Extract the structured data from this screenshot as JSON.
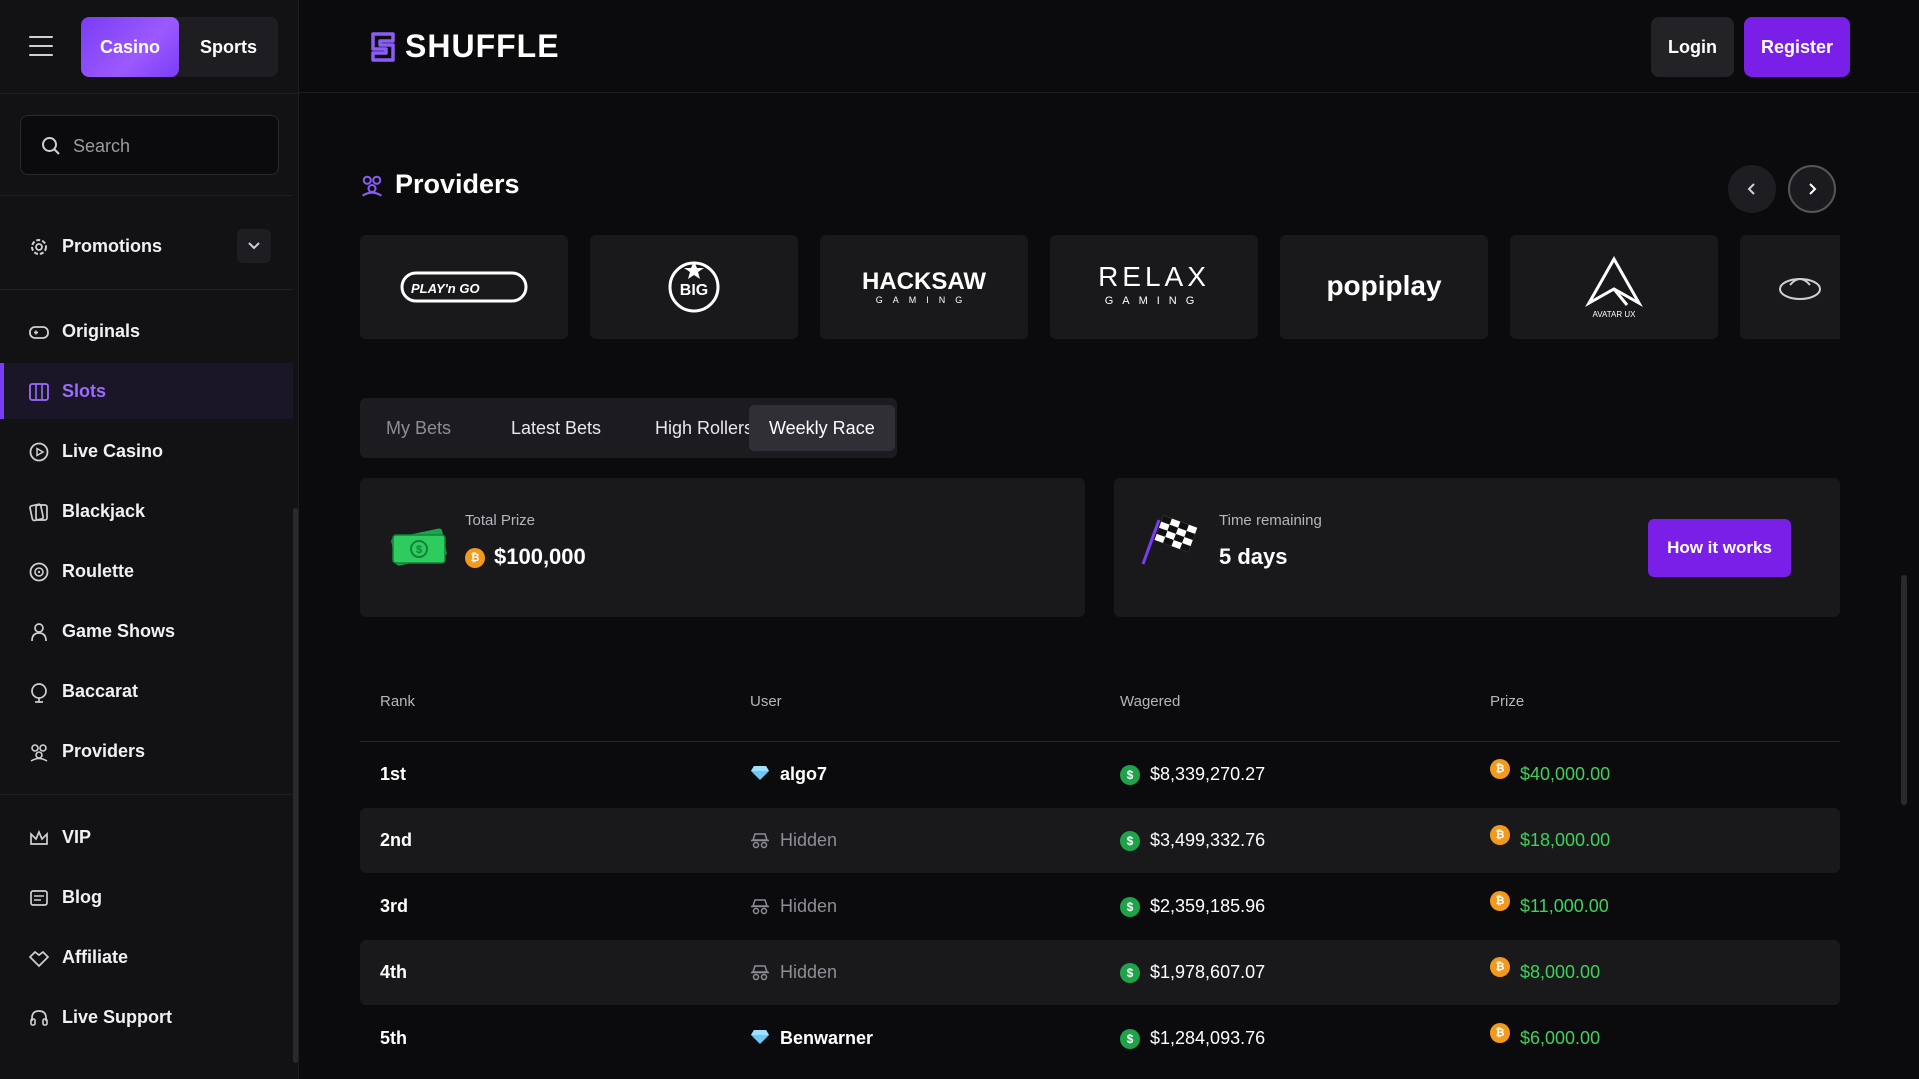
{
  "header": {
    "modes": [
      "Casino",
      "Sports"
    ],
    "brand": "SHUFFLE",
    "login_label": "Login",
    "register_label": "Register"
  },
  "sidebar": {
    "search_placeholder": "Search",
    "promotions_label": "Promotions",
    "items": [
      {
        "label": "Originals",
        "icon": "controller-icon"
      },
      {
        "label": "Slots",
        "icon": "slots-icon"
      },
      {
        "label": "Live Casino",
        "icon": "play-circle-icon"
      },
      {
        "label": "Blackjack",
        "icon": "cards-icon"
      },
      {
        "label": "Roulette",
        "icon": "roulette-icon"
      },
      {
        "label": "Game Shows",
        "icon": "presenter-icon"
      },
      {
        "label": "Baccarat",
        "icon": "baccarat-icon"
      },
      {
        "label": "Providers",
        "icon": "providers-icon"
      }
    ],
    "bottom_items": [
      {
        "label": "VIP",
        "icon": "crown-icon"
      },
      {
        "label": "Blog",
        "icon": "blog-icon"
      },
      {
        "label": "Affiliate",
        "icon": "handshake-icon"
      },
      {
        "label": "Live Support",
        "icon": "headset-icon"
      }
    ],
    "active": "Slots"
  },
  "providers": {
    "title": "Providers",
    "logos": [
      "PLAY'n GO",
      "BIG",
      "HACKSAW",
      "GAMING",
      "RELAX",
      "GAMING",
      "popiplay",
      "AVATAR UX"
    ]
  },
  "bets": {
    "tabs": [
      "My Bets",
      "Latest Bets",
      "High Rollers",
      "Weekly Race"
    ],
    "active_tab": "Weekly Race"
  },
  "race": {
    "total_prize_label": "Total Prize",
    "total_prize_value": "$100,000",
    "time_label": "Time remaining",
    "time_value": "5 days",
    "how_label": "How it works"
  },
  "leaderboard": {
    "columns": [
      "Rank",
      "User",
      "Wagered",
      "Prize"
    ],
    "rows": [
      {
        "rank": "1st",
        "user": "algo7",
        "user_icon": "diamond-icon",
        "wagered": "$8,339,270.27",
        "prize": "$40,000.00"
      },
      {
        "rank": "2nd",
        "user": "Hidden",
        "user_icon": "incognito-icon",
        "wagered": "$3,499,332.76",
        "prize": "$18,000.00"
      },
      {
        "rank": "3rd",
        "user": "Hidden",
        "user_icon": "incognito-icon",
        "wagered": "$2,359,185.96",
        "prize": "$11,000.00"
      },
      {
        "rank": "4th",
        "user": "Hidden",
        "user_icon": "incognito-icon",
        "wagered": "$1,978,607.07",
        "prize": "$8,000.00"
      },
      {
        "rank": "5th",
        "user": "Benwarner",
        "user_icon": "diamond-icon",
        "wagered": "$1,284,093.76",
        "prize": "$6,000.00"
      }
    ]
  },
  "colors": {
    "accent": "#7a1fe8",
    "prize_green": "#3fd15b",
    "background": "#0b0b0d"
  }
}
